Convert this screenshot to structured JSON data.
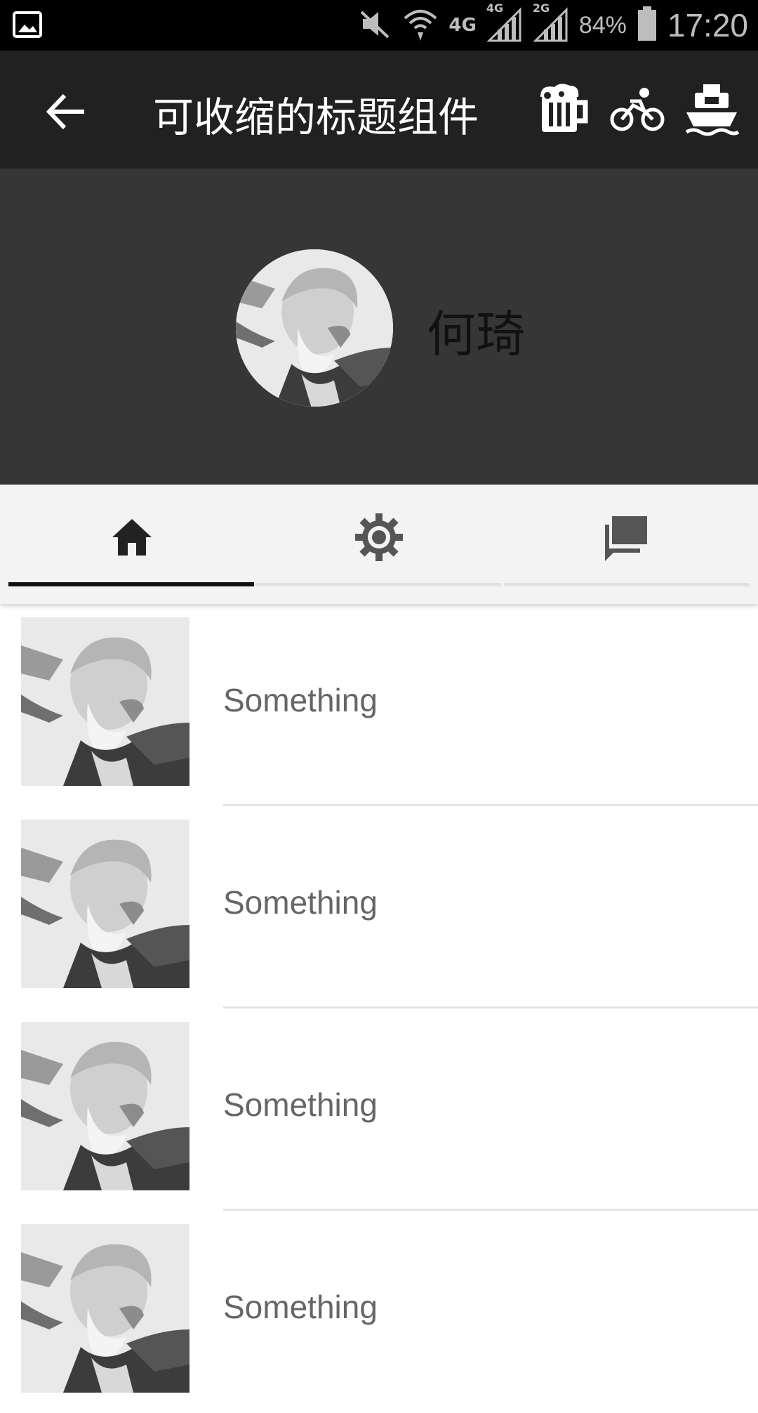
{
  "status_bar": {
    "battery_percent": "84%",
    "time": "17:20",
    "network_primary": "4G",
    "network_sim1": "4G",
    "network_sim2": "2G",
    "icons": [
      "gallery-icon",
      "mute-icon",
      "wifi-icon",
      "signal-icon",
      "signal-icon",
      "battery-icon"
    ]
  },
  "toolbar": {
    "title": "可收缩的标题组件",
    "back_icon": "arrow-back-icon",
    "actions": [
      "beer-mug-icon",
      "bicycle-icon",
      "ship-icon"
    ]
  },
  "header": {
    "name": "何琦",
    "avatar": "avatar-photo"
  },
  "tabs": [
    {
      "icon": "home-icon",
      "active": true
    },
    {
      "icon": "settings-icon",
      "active": false
    },
    {
      "icon": "chat-icon",
      "active": false
    }
  ],
  "list": {
    "items": [
      {
        "label": "Something"
      },
      {
        "label": "Something"
      },
      {
        "label": "Something"
      },
      {
        "label": "Something"
      }
    ]
  },
  "colors": {
    "status_bar": "#000000",
    "toolbar": "#212121",
    "header": "#363636",
    "tab_bar": "#f3f3f3",
    "tab_indicator": "#111111",
    "item_text": "#666666"
  }
}
